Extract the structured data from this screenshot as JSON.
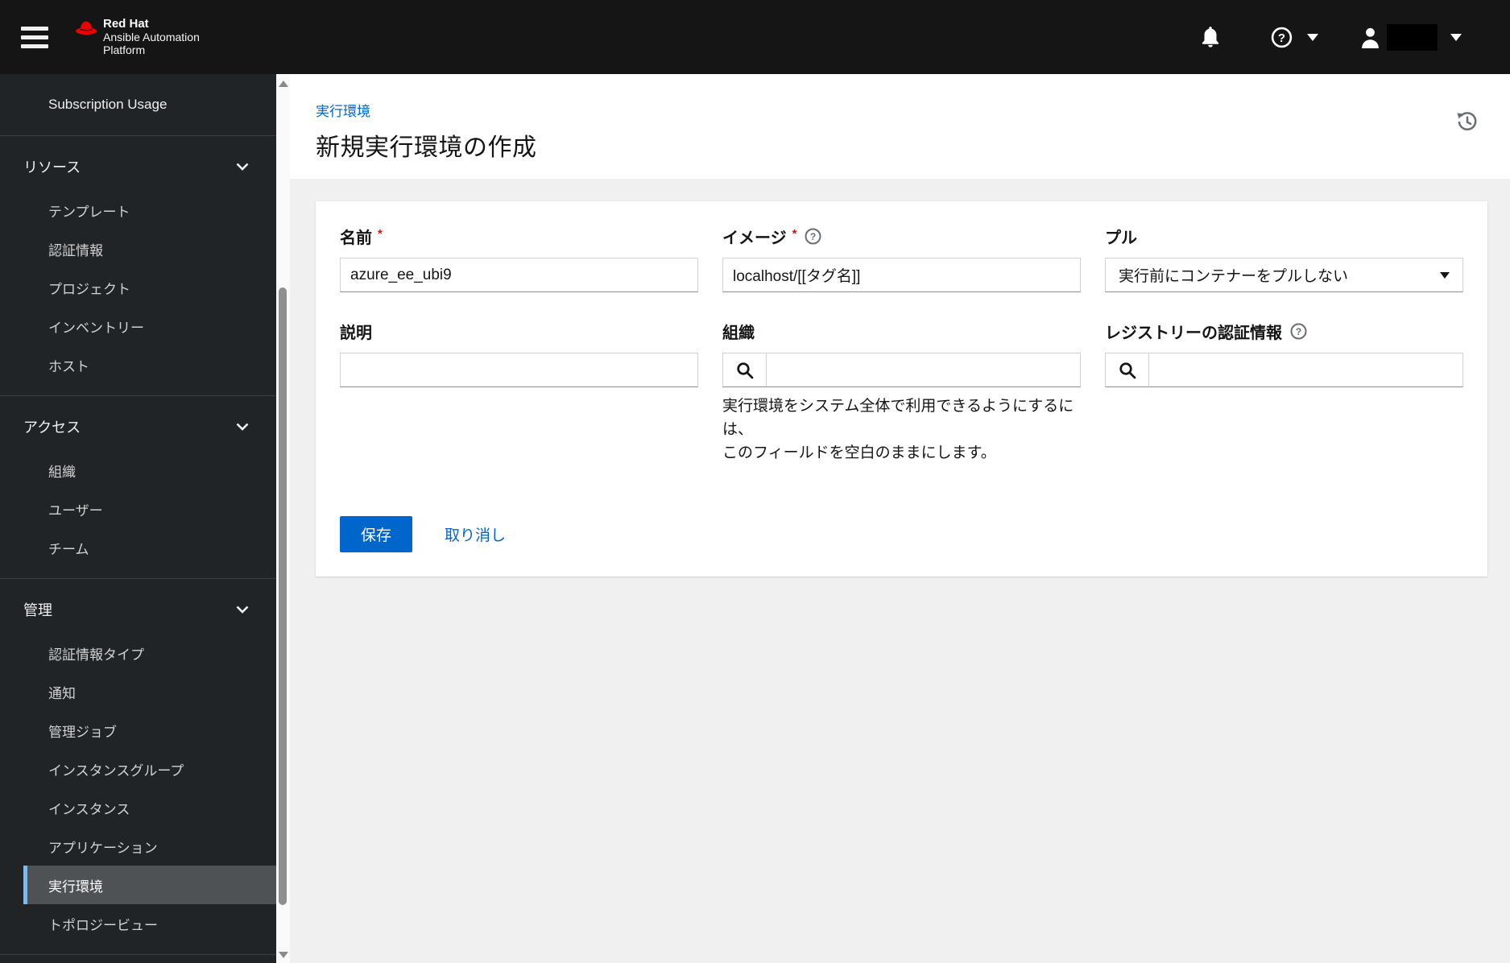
{
  "masthead": {
    "brand": {
      "line1": "Red Hat",
      "line2": "Ansible Automation",
      "line3": "Platform"
    },
    "icons": {
      "menu": "hamburger-icon",
      "notifications": "bell-icon",
      "help": "question-circle-icon",
      "user": "user-icon",
      "dropdown": "caret-down-icon"
    }
  },
  "sidebar": {
    "sections": [
      {
        "items": [
          {
            "label": "Subscription Usage"
          }
        ]
      },
      {
        "title": "リソース",
        "items": [
          {
            "label": "テンプレート"
          },
          {
            "label": "認証情報"
          },
          {
            "label": "プロジェクト"
          },
          {
            "label": "インベントリー"
          },
          {
            "label": "ホスト"
          }
        ]
      },
      {
        "title": "アクセス",
        "items": [
          {
            "label": "組織"
          },
          {
            "label": "ユーザー"
          },
          {
            "label": "チーム"
          }
        ]
      },
      {
        "title": "管理",
        "items": [
          {
            "label": "認証情報タイプ"
          },
          {
            "label": "通知"
          },
          {
            "label": "管理ジョブ"
          },
          {
            "label": "インスタンスグループ"
          },
          {
            "label": "インスタンス"
          },
          {
            "label": "アプリケーション"
          },
          {
            "label": "実行環境",
            "selected": true
          },
          {
            "label": "トポロジービュー"
          }
        ]
      }
    ]
  },
  "page": {
    "breadcrumb": "実行環境",
    "title": "新規実行環境の作成",
    "history_icon": "history-icon"
  },
  "form": {
    "name": {
      "label": "名前",
      "required": "*",
      "value": "azure_ee_ubi9"
    },
    "image": {
      "label": "イメージ",
      "required": "*",
      "value": "localhost/[[タグ名]]",
      "help_icon": "question-circle-icon"
    },
    "pull": {
      "label": "プル",
      "value": "実行前にコンテナーをプルしない"
    },
    "description": {
      "label": "説明",
      "value": ""
    },
    "organization": {
      "label": "組織",
      "value": "",
      "search_icon": "search-icon",
      "helper_line1": "実行環境をシステム全体で利用できるようにするには、",
      "helper_line2": "このフィールドを空白のままにします。"
    },
    "registry_credential": {
      "label": "レジストリーの認証情報",
      "value": "",
      "help_icon": "question-circle-icon",
      "search_icon": "search-icon"
    }
  },
  "actions": {
    "save": "保存",
    "cancel": "取り消し"
  },
  "colors": {
    "primary": "#0066cc",
    "masthead_bg": "#151515",
    "sidebar_bg": "#212427",
    "sidebar_selected_bg": "#4f5255",
    "sidebar_selected_border": "#73bcf7",
    "required_asterisk": "#c9190b",
    "redhat_red": "#ee0000",
    "page_bg": "#f0f0f0"
  }
}
